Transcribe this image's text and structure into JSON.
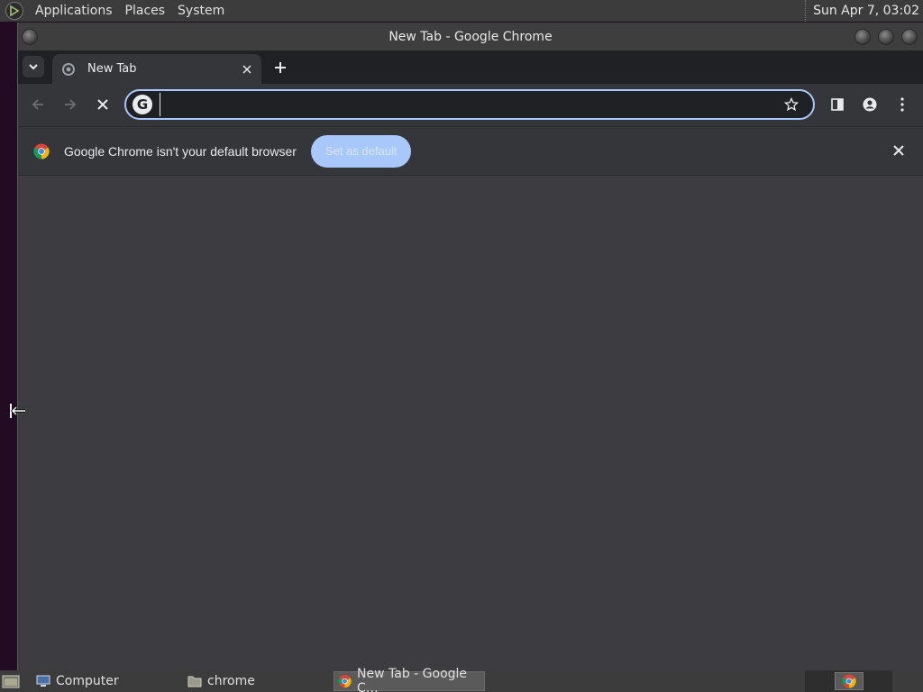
{
  "top_panel": {
    "menus": [
      "Applications",
      "Places",
      "System"
    ],
    "clock": "Sun Apr  7, 03:02"
  },
  "window": {
    "title": "New Tab - Google Chrome"
  },
  "tabs": [
    {
      "title": "New Tab"
    }
  ],
  "omnibox": {
    "value": "",
    "placeholder": ""
  },
  "infobar": {
    "message": "Google Chrome isn't your default browser",
    "button_label": "Set as default"
  },
  "taskbar": {
    "items": [
      {
        "label": "Computer",
        "icon": "computer-icon"
      },
      {
        "label": "chrome",
        "icon": "folder-icon"
      },
      {
        "label": "New Tab - Google C…",
        "icon": "chrome-icon"
      }
    ]
  },
  "colors": {
    "accent": "#a8c7fa",
    "toolbar": "#35363a",
    "tabstrip": "#202124",
    "content": "#3c3c41"
  }
}
